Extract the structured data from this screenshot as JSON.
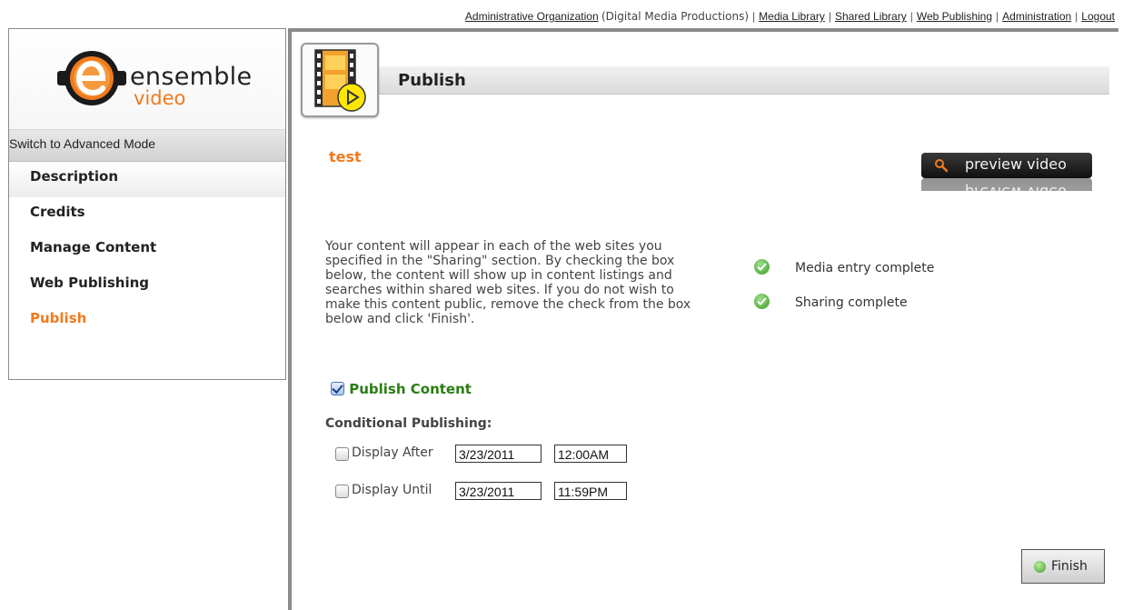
{
  "topnav": {
    "org_link": "Administrative Organization",
    "org_name": "(Digital Media Productions)",
    "links": [
      "Media Library",
      "Shared Library",
      "Web Publishing",
      "Administration",
      "Logout"
    ]
  },
  "sidebar": {
    "logo": {
      "word1": "ensemble",
      "word2": "video"
    },
    "mode_switch": "Switch to Advanced Mode",
    "items": [
      {
        "label": "Description",
        "active": false
      },
      {
        "label": "Credits",
        "active": false
      },
      {
        "label": "Manage Content",
        "active": false
      },
      {
        "label": "Web Publishing",
        "active": false
      },
      {
        "label": "Publish",
        "active": true
      }
    ]
  },
  "main": {
    "title": "Publish",
    "media_title": "test",
    "preview_button": "preview video",
    "info_text": "Your content will appear in each of the web sites you specified in the \"Sharing\" section. By checking the box below, the content will show up in content listings and searches within shared web sites. If you do not wish to make this content public, remove the check from the box below and click 'Finish'.",
    "status": [
      "Media entry complete",
      "Sharing complete"
    ],
    "publish_content": {
      "label": "Publish Content",
      "checked": true
    },
    "conditional": {
      "title": "Conditional Publishing:",
      "after": {
        "label": "Display After",
        "checked": false,
        "date": "3/23/2011",
        "time": "12:00AM"
      },
      "until": {
        "label": "Display Until",
        "checked": false,
        "date": "3/23/2011",
        "time": "11:59PM"
      }
    },
    "finish_button": "Finish"
  },
  "colors": {
    "accent": "#f07a1e",
    "publish_green": "#2a7d14",
    "border_gray": "#8a8a8a"
  }
}
